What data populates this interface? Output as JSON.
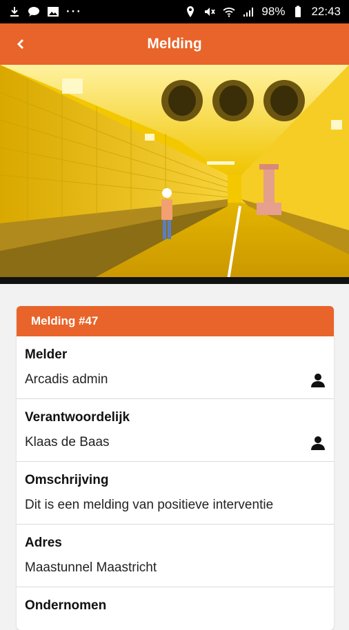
{
  "statusbar": {
    "battery": "98%",
    "time": "22:43",
    "left_icons": [
      "download-icon",
      "message-icon",
      "image-icon",
      "more-icon"
    ],
    "right_icons": [
      "location-icon",
      "mute-icon",
      "wifi-icon",
      "signal-icon",
      "battery-icon"
    ]
  },
  "appbar": {
    "title": "Melding",
    "back_icon": "chevron-left-icon"
  },
  "hero": {
    "description_icon": "tunnel-photo"
  },
  "card": {
    "header": "Melding #47",
    "rows": [
      {
        "label": "Melder",
        "value": "Arcadis admin",
        "icon": "person-icon"
      },
      {
        "label": "Verantwoordelijk",
        "value": "Klaas de Baas",
        "icon": "person-icon"
      },
      {
        "label": "Omschrijving",
        "value": "Dit is een melding van positieve interventie"
      },
      {
        "label": "Adres",
        "value": "Maastunnel Maastricht"
      },
      {
        "label": "Ondernomen",
        "value": ""
      }
    ]
  },
  "colors": {
    "accent": "#e8642a",
    "statusbar": "#000000",
    "background": "#f2f2f2"
  }
}
